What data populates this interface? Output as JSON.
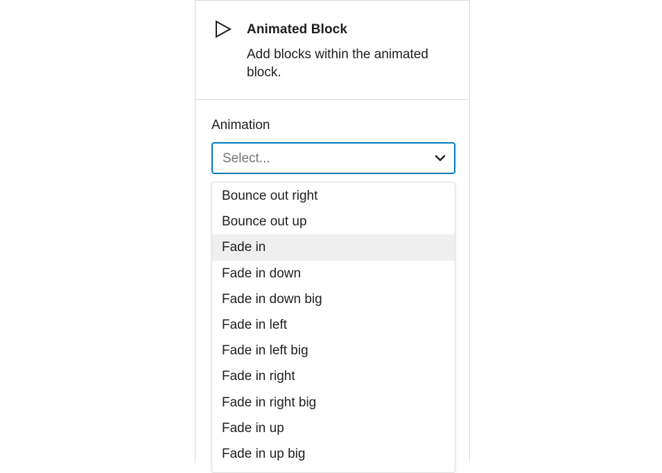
{
  "block": {
    "icon": "play-triangle-icon",
    "title": "Animated Block",
    "description": "Add blocks within the animated block."
  },
  "animation": {
    "label": "Animation",
    "placeholder": "Select...",
    "chevron_icon": "chevron-down-icon",
    "highlighted_option": "Fade in",
    "options": [
      "Bounce out right",
      "Bounce out up",
      "Fade in",
      "Fade in down",
      "Fade in down big",
      "Fade in left",
      "Fade in left big",
      "Fade in right",
      "Fade in right big",
      "Fade in up",
      "Fade in up big"
    ]
  },
  "colors": {
    "focus_border": "#007cba",
    "highlight_bg": "#efefef",
    "placeholder_text": "#757575",
    "divider": "#dcdcde"
  }
}
